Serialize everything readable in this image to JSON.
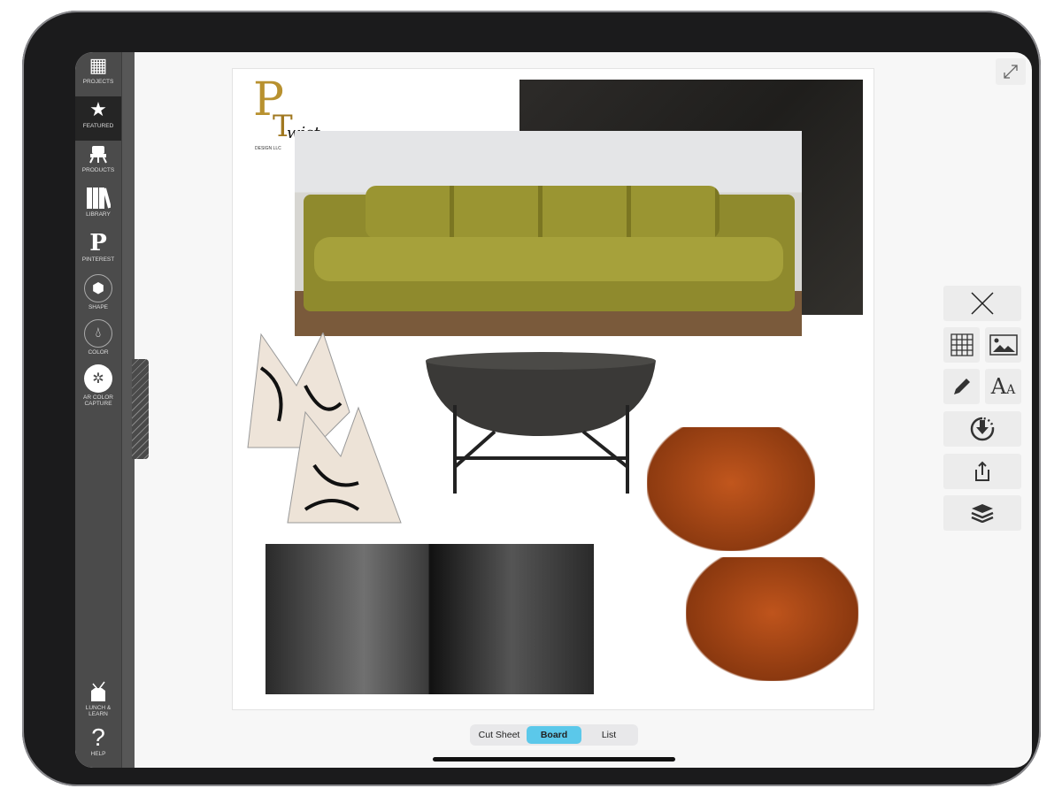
{
  "sidebar": {
    "items": [
      {
        "label": "PROJECTS",
        "icon": "grid-arrow-icon"
      },
      {
        "label": "FEATURED",
        "icon": "star-icon",
        "active": true
      },
      {
        "label": "PRODUCTS",
        "icon": "chair-icon"
      },
      {
        "label": "LIBRARY",
        "icon": "books-icon"
      },
      {
        "label": "PINTEREST",
        "icon": "pinterest-icon"
      },
      {
        "label": "SHAPE",
        "icon": "cube-icon"
      },
      {
        "label": "COLOR",
        "icon": "drop-icon"
      },
      {
        "label": "AR COLOR CAPTURE",
        "icon": "aperture-icon"
      }
    ],
    "bottom": [
      {
        "label": "LUNCH & LEARN",
        "icon": "lunchbox-icon"
      },
      {
        "label": "HELP",
        "icon": "question-icon"
      }
    ]
  },
  "board": {
    "logo_text": "PT Twist DESIGN LLC"
  },
  "toolbar": {
    "tools": [
      "close",
      "grid",
      "image",
      "pencil",
      "text",
      "download",
      "share",
      "layers"
    ]
  },
  "view_toggle": {
    "options": [
      "Cut Sheet",
      "Board",
      "List"
    ],
    "selected": "Board"
  },
  "colors": {
    "accent": "#5bc8ea",
    "sidebar": "#4b4b4b"
  }
}
